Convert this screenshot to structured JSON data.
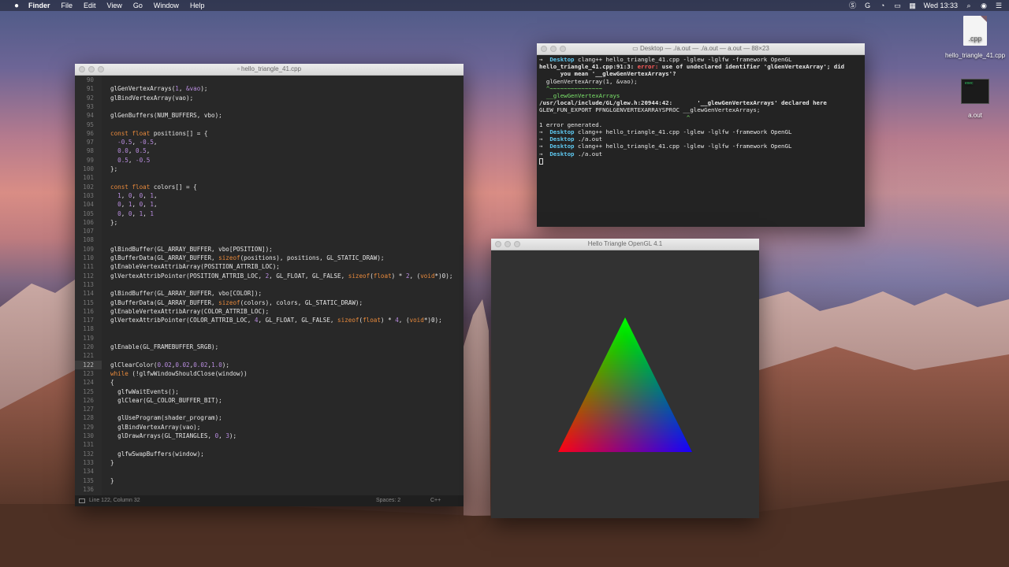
{
  "menubar": {
    "app_name": "Finder",
    "menus": [
      "File",
      "Edit",
      "View",
      "Go",
      "Window",
      "Help"
    ],
    "clock": "Wed 13:33",
    "status_icons": [
      "skype-icon",
      "google-icon",
      "wifi-icon",
      "airplay-icon",
      "keyboard-icon",
      "search-icon",
      "siri-icon",
      "notification-center-icon"
    ]
  },
  "desktop": {
    "icons": [
      {
        "label": "hello_triangle_41.cpp",
        "badge": ".cpp",
        "kind": "cpp-file-icon"
      },
      {
        "label": "a.out",
        "badge": "exec",
        "kind": "executable-file-icon"
      }
    ]
  },
  "editor": {
    "title": "hello_triangle_41.cpp",
    "status": {
      "position": "Line 122, Column 32",
      "indent": "Spaces: 2",
      "syntax": "C++"
    },
    "current_line": "122",
    "lines": [
      {
        "n": "90",
        "t": ""
      },
      {
        "n": "91",
        "t": "glGenVertexArrays(1, &vao);"
      },
      {
        "n": "92",
        "t": "glBindVertexArray(vao);"
      },
      {
        "n": "93",
        "t": ""
      },
      {
        "n": "94",
        "t": "glGenBuffers(NUM_BUFFERS, vbo);"
      },
      {
        "n": "95",
        "t": ""
      },
      {
        "n": "96",
        "t": "const float positions[] = {"
      },
      {
        "n": "97",
        "t": "  -0.5, -0.5,"
      },
      {
        "n": "98",
        "t": "  0.0, 0.5,"
      },
      {
        "n": "99",
        "t": "  0.5, -0.5"
      },
      {
        "n": "100",
        "t": "};"
      },
      {
        "n": "101",
        "t": ""
      },
      {
        "n": "102",
        "t": "const float colors[] = {"
      },
      {
        "n": "103",
        "t": "  1, 0, 0, 1,"
      },
      {
        "n": "104",
        "t": "  0, 1, 0, 1,"
      },
      {
        "n": "105",
        "t": "  0, 0, 1, 1"
      },
      {
        "n": "106",
        "t": "};"
      },
      {
        "n": "107",
        "t": ""
      },
      {
        "n": "108",
        "t": ""
      },
      {
        "n": "109",
        "t": "glBindBuffer(GL_ARRAY_BUFFER, vbo[POSITION]);"
      },
      {
        "n": "110",
        "t": "glBufferData(GL_ARRAY_BUFFER, sizeof(positions), positions, GL_STATIC_DRAW);"
      },
      {
        "n": "111",
        "t": "glEnableVertexAttribArray(POSITION_ATTRIB_LOC);"
      },
      {
        "n": "112",
        "t": "glVertexAttribPointer(POSITION_ATTRIB_LOC, 2, GL_FLOAT, GL_FALSE, sizeof(float) * 2, (void*)0);"
      },
      {
        "n": "113",
        "t": ""
      },
      {
        "n": "114",
        "t": "glBindBuffer(GL_ARRAY_BUFFER, vbo[COLOR]);"
      },
      {
        "n": "115",
        "t": "glBufferData(GL_ARRAY_BUFFER, sizeof(colors), colors, GL_STATIC_DRAW);"
      },
      {
        "n": "116",
        "t": "glEnableVertexAttribArray(COLOR_ATTRIB_LOC);"
      },
      {
        "n": "117",
        "t": "glVertexAttribPointer(COLOR_ATTRIB_LOC, 4, GL_FLOAT, GL_FALSE, sizeof(float) * 4, (void*)0);"
      },
      {
        "n": "118",
        "t": ""
      },
      {
        "n": "119",
        "t": ""
      },
      {
        "n": "120",
        "t": "glEnable(GL_FRAMEBUFFER_SRGB);"
      },
      {
        "n": "121",
        "t": ""
      },
      {
        "n": "122",
        "t": "glClearColor(0.02,0.02,0.02,1.0);"
      },
      {
        "n": "123",
        "t": "while (!glfwWindowShouldClose(window))"
      },
      {
        "n": "124",
        "t": "{"
      },
      {
        "n": "125",
        "t": "  glfwWaitEvents();"
      },
      {
        "n": "126",
        "t": "  glClear(GL_COLOR_BUFFER_BIT);"
      },
      {
        "n": "127",
        "t": ""
      },
      {
        "n": "128",
        "t": "  glUseProgram(shader_program);"
      },
      {
        "n": "129",
        "t": "  glBindVertexArray(vao);"
      },
      {
        "n": "130",
        "t": "  glDrawArrays(GL_TRIANGLES, 0, 3);"
      },
      {
        "n": "131",
        "t": ""
      },
      {
        "n": "132",
        "t": "  glfwSwapBuffers(window);"
      },
      {
        "n": "133",
        "t": "}"
      },
      {
        "n": "134",
        "t": ""
      },
      {
        "n": "135",
        "t": "}"
      },
      {
        "n": "136",
        "t": ""
      }
    ]
  },
  "terminal": {
    "title": "Desktop — ./a.out — ./a.out — a.out — 88×23",
    "lines": [
      {
        "prompt": true,
        "dir": "Desktop",
        "text": " clang++ hello_triangle_41.cpp -lglew -lglfw -framework OpenGL"
      },
      {
        "err": true,
        "pre": "hello_triangle_41.cpp:91:3: ",
        "errword": "error:",
        "text": " use of undeclared identifier 'glGenVertexArray'; did"
      },
      {
        "bold": true,
        "text": "      you mean '__glewGenVertexArrays'?"
      },
      {
        "text": "  glGenVertexArray(1, &vao);"
      },
      {
        "green": true,
        "text": "  ^~~~~~~~~~~~~~~~"
      },
      {
        "green": true,
        "text": "  __glewGenVertexArrays"
      },
      {
        "bold": true,
        "text": "/usr/local/include/GL/glew.h:20944:42:       '__glewGenVertexArrays' declared here"
      },
      {
        "text": "GLEW_FUN_EXPORT PFNGLGENVERTEXARRAYSPROC __glewGenVertexArrays;"
      },
      {
        "green": true,
        "text": "                                          ^"
      },
      {
        "text": "1 error generated."
      },
      {
        "prompt": true,
        "dir": "Desktop",
        "text": " clang++ hello_triangle_41.cpp -lglew -lglfw -framework OpenGL"
      },
      {
        "prompt": true,
        "dir": "Desktop",
        "text": " ./a.out"
      },
      {
        "prompt": true,
        "dir": "Desktop",
        "text": " clang++ hello_triangle_41.cpp -lglew -lglfw -framework OpenGL"
      },
      {
        "prompt": true,
        "dir": "Desktop",
        "text": " ./a.out"
      }
    ],
    "prompt_arrow": "→"
  },
  "gl_window": {
    "title": "Hello Triangle OpenGL 4.1",
    "vertex_colors": [
      "#ff0000",
      "#00ff00",
      "#0000ff"
    ]
  }
}
